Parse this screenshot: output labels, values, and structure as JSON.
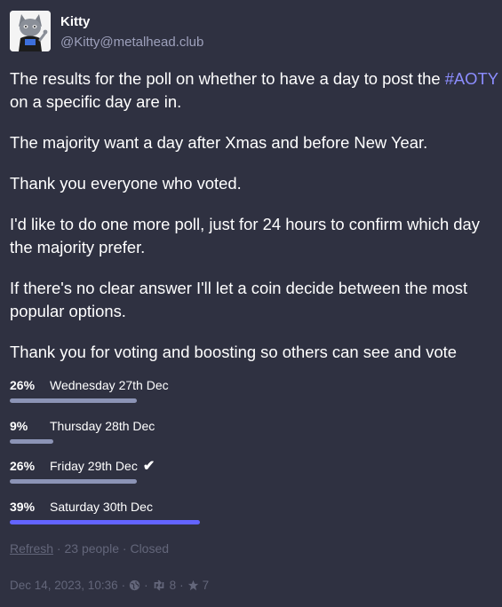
{
  "author": {
    "display_name": "Kitty",
    "handle": "@Kitty@metalhead.club"
  },
  "post": {
    "p1_before": "The results for the poll on whether to have a day to post the ",
    "p1_hashtag": "#AOTY",
    "p1_after": " on a specific day are in.",
    "p2": "The majority want a day after Xmas and before New Year.",
    "p3": "Thank you everyone who voted.",
    "p4": "I'd like to do one more poll, just for 24 hours to confirm which day the majority prefer.",
    "p5": "If there's no clear answer I'll let a coin decide between the most popular options.",
    "p6": "Thank you for voting and boosting so others can see and vote"
  },
  "poll": {
    "options": [
      {
        "percent": "26%",
        "label": "Wednesday 27th Dec",
        "fraction": 0.26,
        "voted": false,
        "leading": false
      },
      {
        "percent": "9%",
        "label": "Thursday 28th Dec",
        "fraction": 0.09,
        "voted": false,
        "leading": false
      },
      {
        "percent": "26%",
        "label": "Friday 29th Dec",
        "fraction": 0.26,
        "voted": true,
        "leading": false
      },
      {
        "percent": "39%",
        "label": "Saturday 30th Dec",
        "fraction": 0.39,
        "voted": false,
        "leading": true
      }
    ],
    "refresh_label": "Refresh",
    "voters": "23 people",
    "status": "Closed"
  },
  "meta": {
    "timestamp": "Dec 14, 2023, 10:36",
    "visibility_icon": "globe-icon",
    "boost_count": "8",
    "favourite_count": "7"
  },
  "colors": {
    "background": "#2f3141",
    "accent": "#6364ff",
    "bar": "#8c94b6",
    "muted": "#63667a",
    "hashtag": "#8c8dff"
  }
}
